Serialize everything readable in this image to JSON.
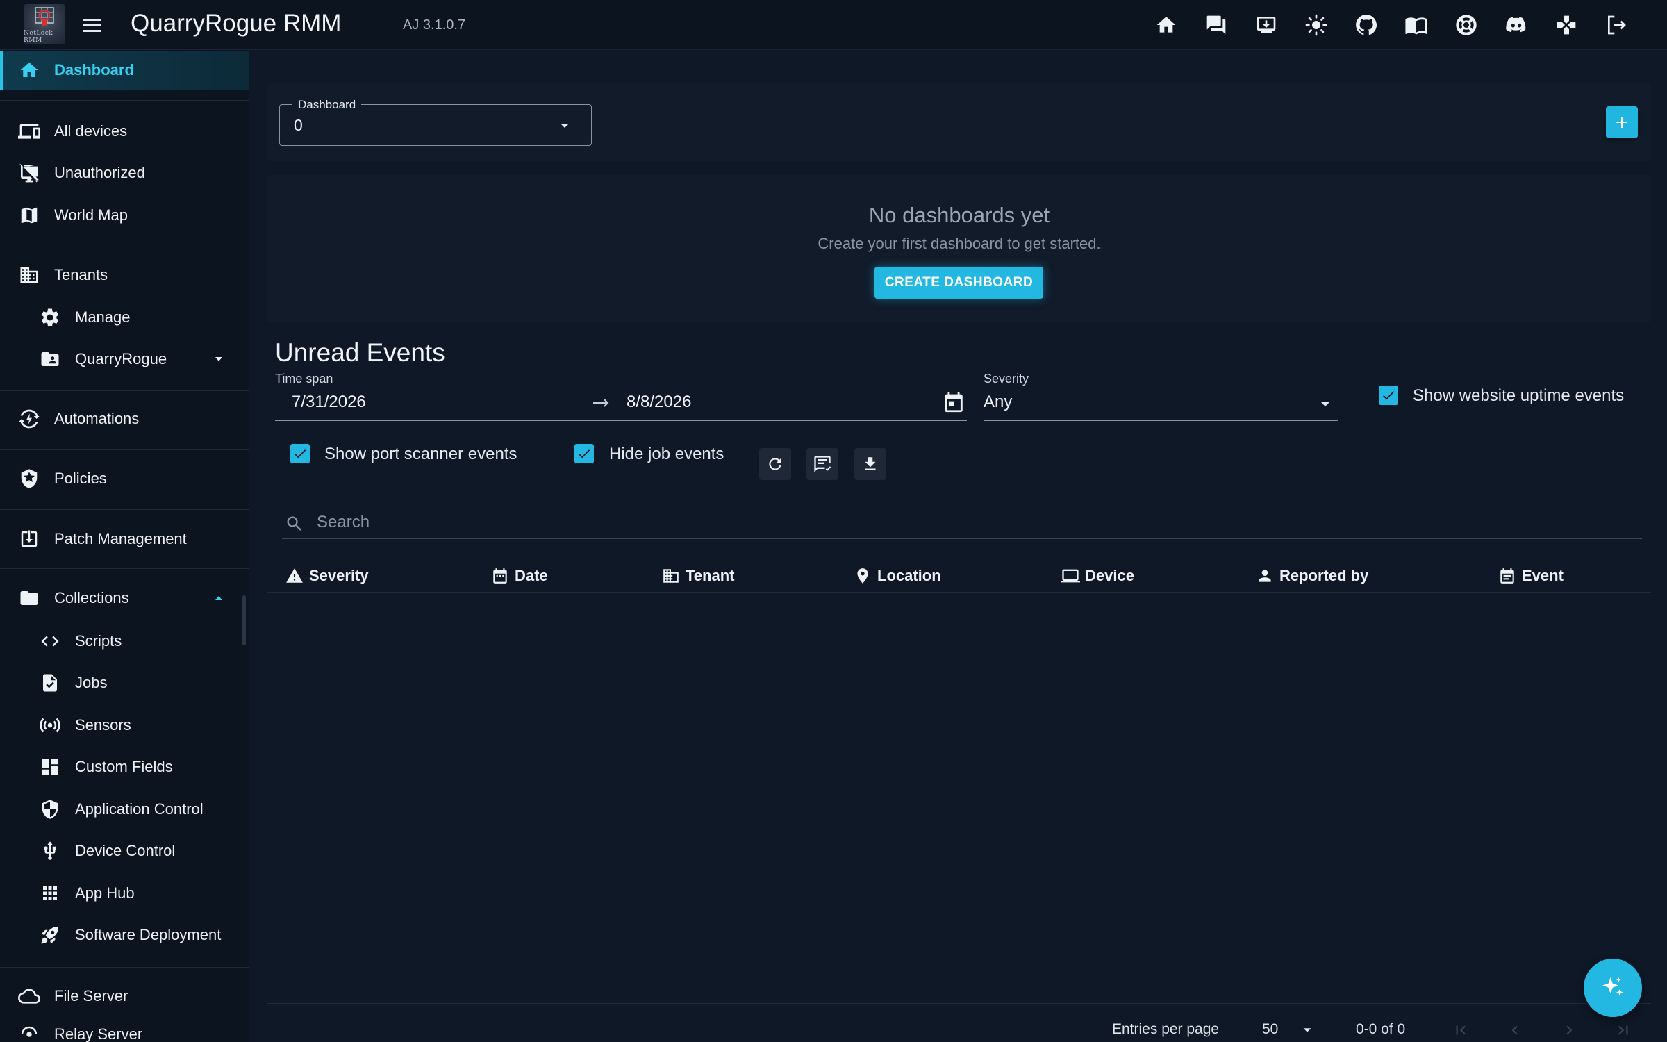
{
  "app": {
    "title": "QuarryRogue RMM",
    "version": "AJ 3.1.0.7",
    "logo_text": "NetLock RMM"
  },
  "topbar": {
    "icons": [
      "home-icon",
      "chat-icon",
      "download-icon",
      "brightness-icon",
      "github-icon",
      "docs-icon",
      "support-icon",
      "discord-icon",
      "gamepad-icon",
      "logout-icon"
    ]
  },
  "sidebar": {
    "dashboard": "Dashboard",
    "all_devices": "All devices",
    "unauthorized": "Unauthorized",
    "world_map": "World Map",
    "tenants": "Tenants",
    "manage": "Manage",
    "quarryrogue": "QuarryRogue",
    "automations": "Automations",
    "policies": "Policies",
    "patch_management": "Patch Management",
    "collections": "Collections",
    "scripts": "Scripts",
    "jobs": "Jobs",
    "sensors": "Sensors",
    "custom_fields": "Custom Fields",
    "application_control": "Application Control",
    "device_control": "Device Control",
    "app_hub": "App Hub",
    "software_deployment": "Software Deployment",
    "file_server": "File Server",
    "relay_server": "Relay Server"
  },
  "dashboard": {
    "select_label": "Dashboard",
    "select_value": "0",
    "empty_title": "No dashboards yet",
    "empty_subtitle": "Create your first dashboard to get started.",
    "create_button": "CREATE DASHBOARD"
  },
  "events": {
    "title": "Unread Events",
    "time_span_label": "Time span",
    "date_from": "7/31/2026",
    "date_to": "8/8/2026",
    "severity_label": "Severity",
    "severity_value": "Any",
    "show_website_uptime": "Show website uptime events",
    "show_port_scanner": "Show port scanner events",
    "hide_job_events": "Hide job events",
    "search_placeholder": "Search",
    "columns": [
      "Severity",
      "Date",
      "Tenant",
      "Location",
      "Device",
      "Reported by",
      "Event"
    ],
    "checkboxes": {
      "website_uptime": true,
      "port_scanner": true,
      "hide_jobs": true
    }
  },
  "pagination": {
    "entries_label": "Entries per page",
    "entries_value": "50",
    "range": "0-0 of 0"
  },
  "colors": {
    "accent": "#22b8e2",
    "background": "#0f1827",
    "surface": "#111b2a",
    "sidebar": "#0c1420"
  }
}
